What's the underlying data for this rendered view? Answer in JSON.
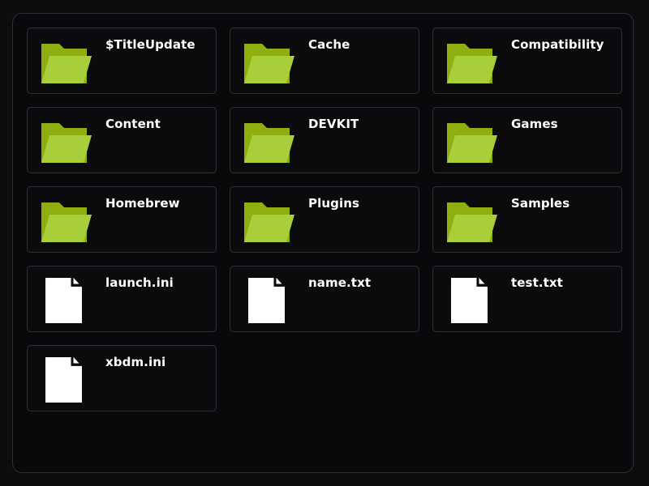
{
  "colors": {
    "folder_back": "#8fae0f",
    "folder_front": "#a8cf3b",
    "file": "#ffffff"
  },
  "items": [
    {
      "name": "$TitleUpdate",
      "type": "folder",
      "icon": "folder-icon"
    },
    {
      "name": "Cache",
      "type": "folder",
      "icon": "folder-icon"
    },
    {
      "name": "Compatibility",
      "type": "folder",
      "icon": "folder-icon"
    },
    {
      "name": "Content",
      "type": "folder",
      "icon": "folder-icon"
    },
    {
      "name": "DEVKIT",
      "type": "folder",
      "icon": "folder-icon"
    },
    {
      "name": "Games",
      "type": "folder",
      "icon": "folder-icon"
    },
    {
      "name": "Homebrew",
      "type": "folder",
      "icon": "folder-icon"
    },
    {
      "name": "Plugins",
      "type": "folder",
      "icon": "folder-icon"
    },
    {
      "name": "Samples",
      "type": "folder",
      "icon": "folder-icon"
    },
    {
      "name": "launch.ini",
      "type": "file",
      "icon": "file-icon"
    },
    {
      "name": "name.txt",
      "type": "file",
      "icon": "file-icon"
    },
    {
      "name": "test.txt",
      "type": "file",
      "icon": "file-icon"
    },
    {
      "name": "xbdm.ini",
      "type": "file",
      "icon": "file-icon"
    }
  ]
}
